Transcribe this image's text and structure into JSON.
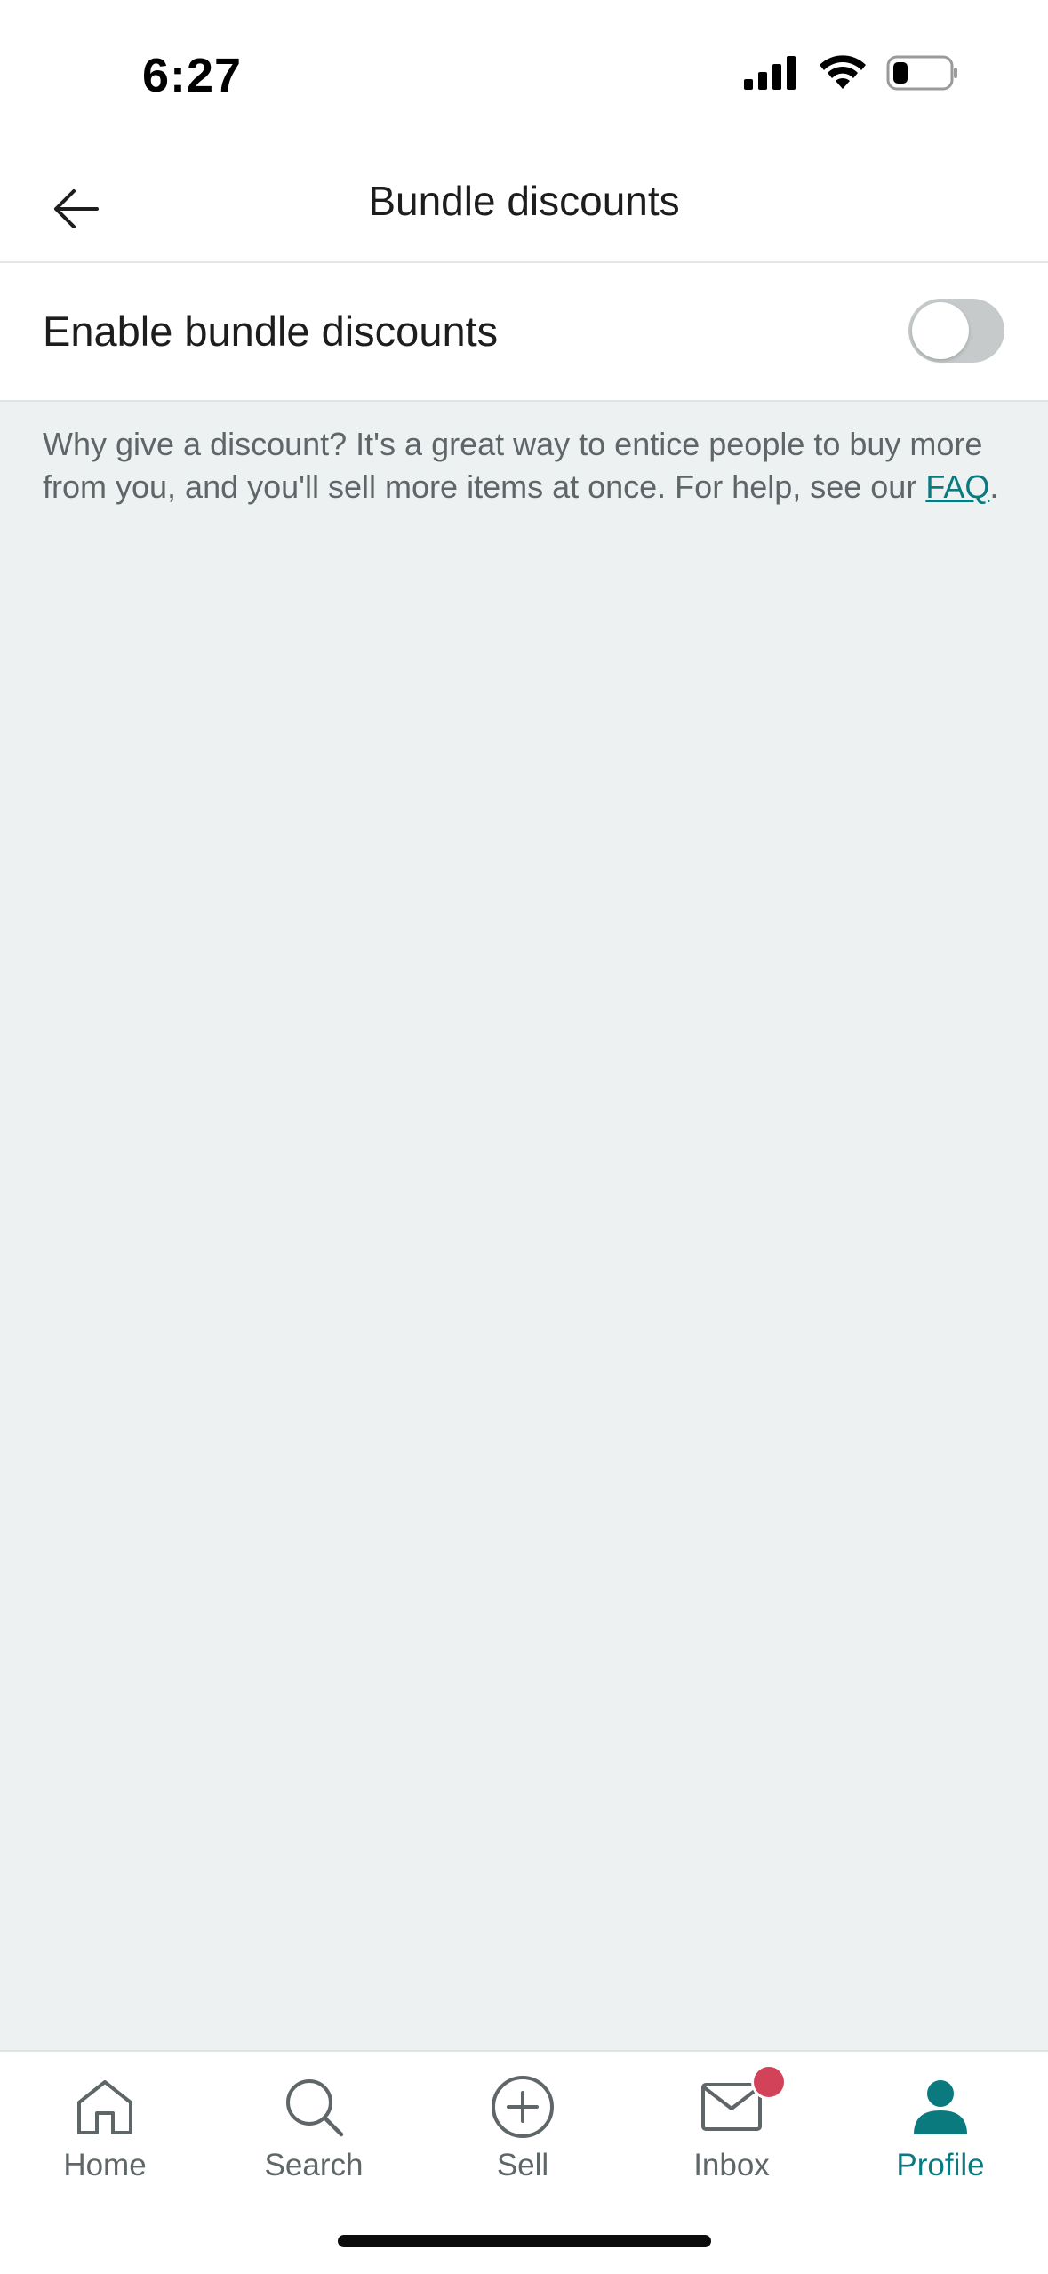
{
  "status_bar": {
    "time": "6:27"
  },
  "nav": {
    "title": "Bundle discounts",
    "back_icon": "arrow-left-icon"
  },
  "toggle": {
    "label": "Enable bundle discounts",
    "enabled": false,
    "track_color": "#c6cacb"
  },
  "help": {
    "text_before": "Why give a discount? It's a great way to entice people to buy more from you, and you'll sell more items at once. For help, see our ",
    "link_text": "FAQ",
    "text_after": "."
  },
  "tabs": [
    {
      "label": "Home",
      "icon": "home-icon",
      "active": false
    },
    {
      "label": "Search",
      "icon": "search-icon",
      "active": false
    },
    {
      "label": "Sell",
      "icon": "plus-circle-icon",
      "active": false
    },
    {
      "label": "Inbox",
      "icon": "mail-icon",
      "active": false,
      "badge": true
    },
    {
      "label": "Profile",
      "icon": "person-icon",
      "active": true
    }
  ],
  "colors": {
    "accent": "#0a7a7f",
    "badge": "#d2435a",
    "background": "#edf1f2",
    "muted_text": "#5f6668"
  }
}
